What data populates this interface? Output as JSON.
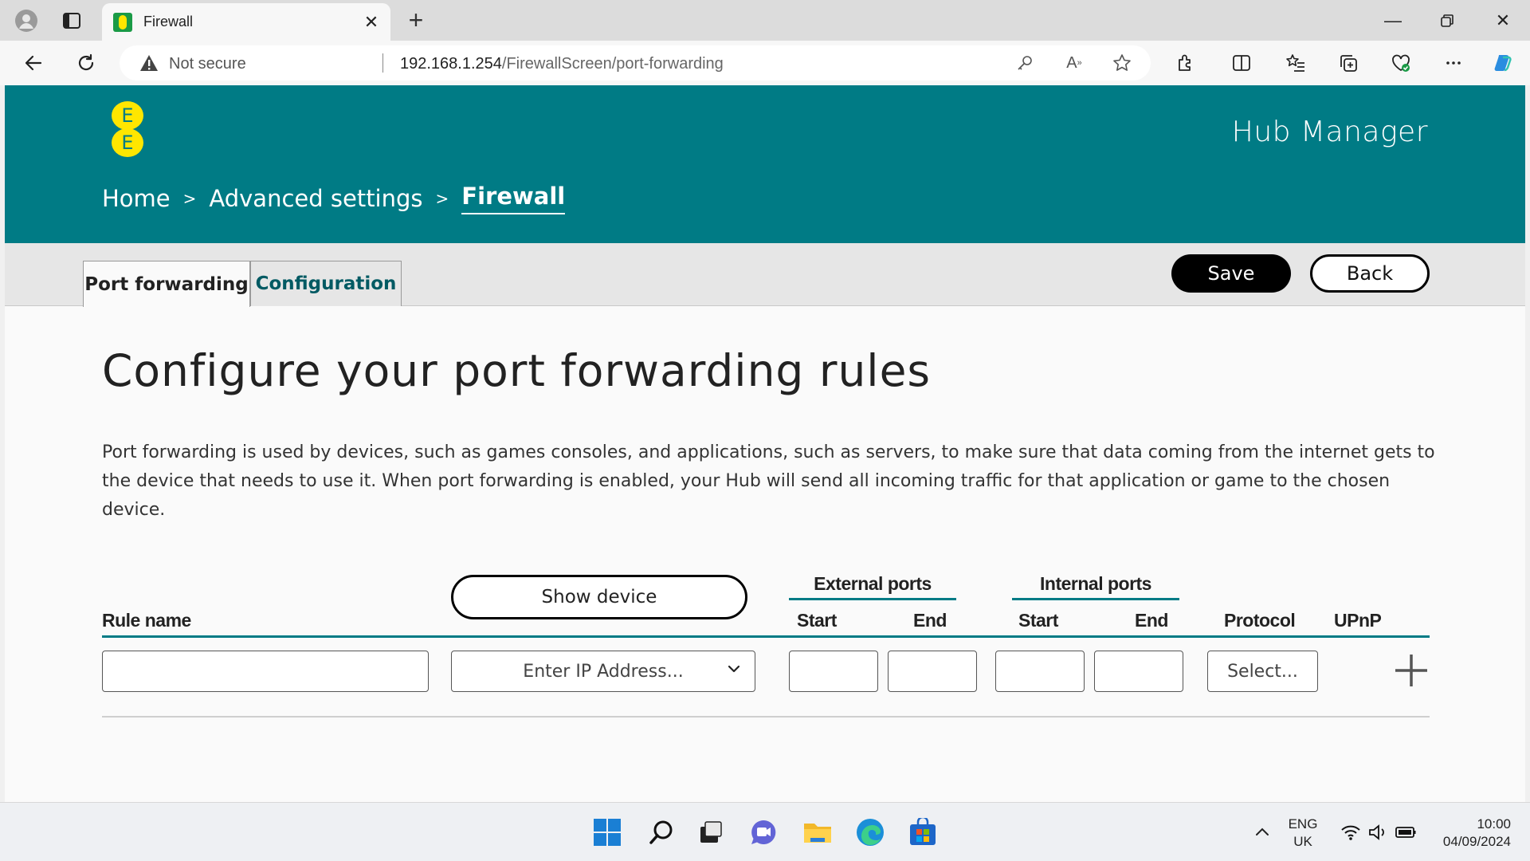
{
  "browser": {
    "tab_title": "Firewall",
    "new_tab": "+",
    "address": {
      "security": "Not secure",
      "url_host": "192.168.1.254",
      "url_path": "/FirewallScreen/port-forwarding"
    },
    "icons": [
      "profile-icon",
      "tab-actions-icon",
      "back-icon",
      "refresh-icon",
      "password-key-icon",
      "read-aloud-icon",
      "favorite-star-icon",
      "extensions-icon",
      "split-screen-icon",
      "favorites-icon",
      "collections-icon",
      "browser-essentials-icon",
      "more-icon",
      "copilot-icon"
    ]
  },
  "header": {
    "logo_letters": [
      "E",
      "E"
    ],
    "app_title": "Hub Manager",
    "breadcrumb": [
      "Home",
      "Advanced settings",
      "Firewall"
    ]
  },
  "tabs": [
    {
      "label": "Port forwarding",
      "active": true
    },
    {
      "label": "Configuration",
      "active": false
    }
  ],
  "actions": {
    "save": "Save",
    "back": "Back"
  },
  "main": {
    "title": "Configure your port forwarding rules",
    "description": "Port forwarding is used by devices, such as games consoles, and applications, such as servers, to make sure that data coming from the internet gets to the device that needs to use it. When port forwarding is enabled, your Hub will send all incoming traffic for that application or game to the chosen device."
  },
  "table": {
    "show_device": "Show device",
    "headers": {
      "rule_name": "Rule name",
      "external_ports": "External ports",
      "internal_ports": "Internal ports",
      "start": "Start",
      "end": "End",
      "protocol": "Protocol",
      "upnp": "UPnP"
    },
    "row": {
      "rule_name_value": "",
      "ip_placeholder": "Enter IP Address...",
      "ext_start": "",
      "ext_end": "",
      "int_start": "",
      "int_end": "",
      "protocol_placeholder": "Select..."
    }
  },
  "taskbar": {
    "lang": "ENG",
    "region": "UK",
    "time": "10:00",
    "date": "04/09/2024"
  },
  "colors": {
    "brand_teal": "#007b85",
    "brand_yellow": "#ffe600"
  }
}
